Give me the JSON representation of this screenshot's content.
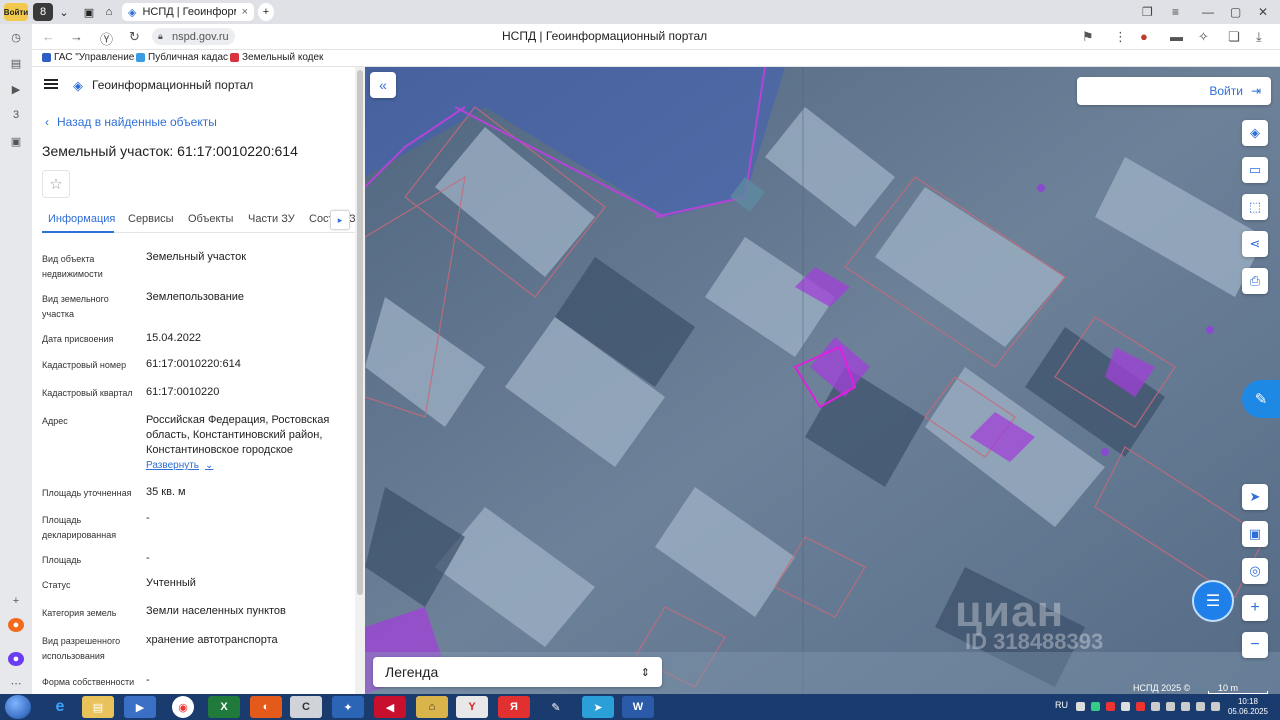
{
  "browser": {
    "user_badge": "Войти",
    "tab_count": "8",
    "active_tab_title": "НСПД | Геоинформацион",
    "url": "nspd.gov.ru",
    "page_title": "НСПД | Геоинформационный портал",
    "bookmarks": [
      {
        "label": "ГАС \"Управление",
        "color": "#2c5ec5"
      },
      {
        "label": "Публичная кадас",
        "color": "#3a9be0"
      },
      {
        "label": "Земельный кодек",
        "color": "#d8343f"
      }
    ]
  },
  "panel": {
    "brand": "Геоинформационный портал",
    "back_link": "Назад в найденные объекты",
    "title": "Земельный участок: 61:17:0010220:614",
    "tabs": [
      "Информация",
      "Сервисы",
      "Объекты",
      "Части ЗУ",
      "Сост",
      "З"
    ],
    "active_tab": 0,
    "expand_link": "Развернуть",
    "fields": [
      {
        "label": "Вид объекта недвижимости",
        "value": "Земельный участок"
      },
      {
        "label": "Вид земельного участка",
        "value": "Землепользование"
      },
      {
        "label": "Дата присвоения",
        "value": "15.04.2022"
      },
      {
        "label": "Кадастровый номер",
        "value": "61:17:0010220:614"
      },
      {
        "label": "Кадастровый квартал",
        "value": "61:17:0010220"
      },
      {
        "label": "Адрес",
        "value": "Российская Федерация, Ростовская область, Константиновский район, Константиновское городское"
      },
      {
        "label": "Площадь уточненная",
        "value": "35 кв. м"
      },
      {
        "label": "Площадь декларированная",
        "value": "-"
      },
      {
        "label": "Площадь",
        "value": "-"
      },
      {
        "label": "Статус",
        "value": "Учтенный"
      },
      {
        "label": "Категория земель",
        "value": "Земли населенных пунктов"
      },
      {
        "label": "Вид разрешенного использования",
        "value": "хранение автотранспорта"
      },
      {
        "label": "Форма собственности",
        "value": "-"
      }
    ]
  },
  "map": {
    "login_label": "Войти",
    "legend_label": "Легенда",
    "copyright": "НСПД 2025 ©",
    "scale": "10 m",
    "watermark": "циан",
    "watermark_id": "ID 318488393"
  },
  "taskbar": {
    "lang": "RU",
    "time": "10:18",
    "date": "05.06.2025"
  }
}
